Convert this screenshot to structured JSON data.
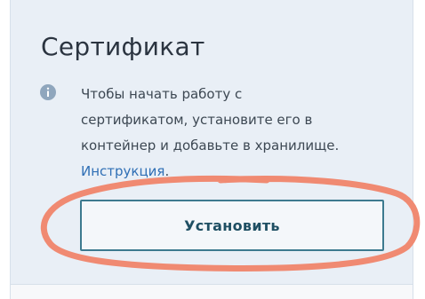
{
  "certificate_card": {
    "title": "Сертификат",
    "info_icon": "info-circle-icon",
    "info_lines": [
      "Чтобы начать работу с",
      "сертификатом, установите его в",
      "контейнер и добавьте в хранилище."
    ],
    "instruction_link": "Инструкция",
    "instruction_suffix": ".",
    "install_button_label": "Установить"
  },
  "colors": {
    "panel_background": "#e9eff6",
    "button_border": "#3d7a8f",
    "button_text": "#1f4f63",
    "link": "#2f6fb5",
    "annotation_stroke": "#f08a72"
  }
}
